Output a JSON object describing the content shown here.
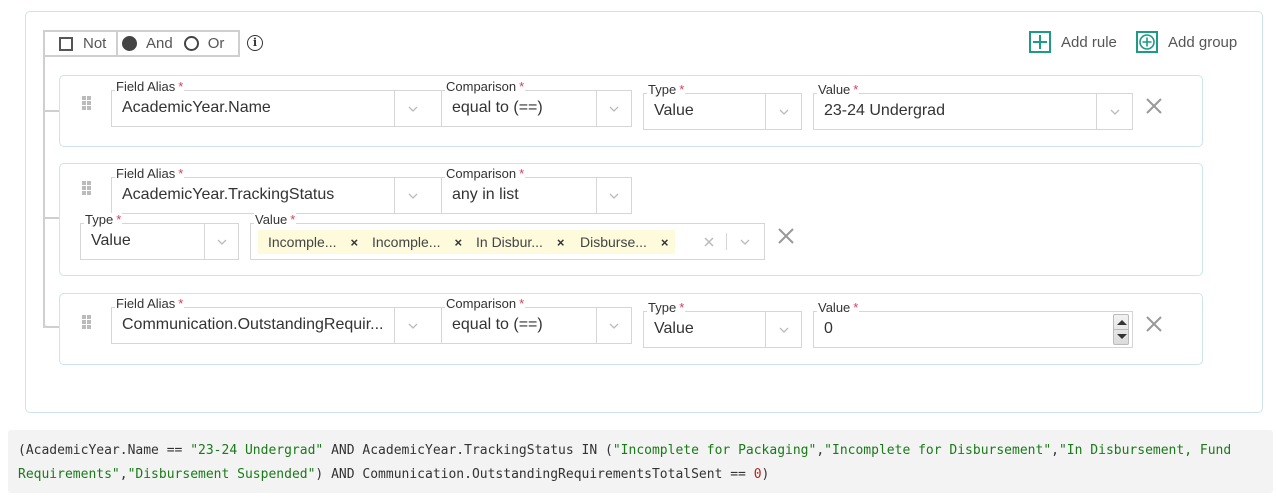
{
  "group": {
    "not_label": "Not",
    "and_label": "And",
    "or_label": "Or",
    "not_checked": false,
    "combinator": "And",
    "add_rule_label": "Add rule",
    "add_group_label": "Add group",
    "accent_color": "#1f9a85"
  },
  "rules": [
    {
      "field_alias_label": "Field Alias",
      "field_alias_value": "AcademicYear.Name",
      "comparison_label": "Comparison",
      "comparison_value": "equal to (==)",
      "type_label": "Type",
      "type_value": "Value",
      "value_label": "Value",
      "value_value": "23-24 Undergrad"
    },
    {
      "field_alias_label": "Field Alias",
      "field_alias_value": "AcademicYear.TrackingStatus",
      "comparison_label": "Comparison",
      "comparison_value": "any in list",
      "type_label": "Type",
      "type_value": "Value",
      "value_label": "Value",
      "value_tags": [
        "Incomple...",
        "Incomple...",
        "In Disbur...",
        "Disburse..."
      ],
      "tag_remove": "×"
    },
    {
      "field_alias_label": "Field Alias",
      "field_alias_value": "Communication.OutstandingRequir...",
      "comparison_label": "Comparison",
      "comparison_value": "equal to (==)",
      "type_label": "Type",
      "type_value": "Value",
      "value_label": "Value",
      "value_value": "0"
    }
  ],
  "required_marker": "*",
  "query": {
    "segments": [
      {
        "t": "plain",
        "v": "(AcademicYear.Name == "
      },
      {
        "t": "str",
        "v": "\"23-24 Undergrad\""
      },
      {
        "t": "plain",
        "v": " AND AcademicYear.TrackingStatus IN ("
      },
      {
        "t": "str",
        "v": "\"Incomplete for Packaging\""
      },
      {
        "t": "plain",
        "v": ","
      },
      {
        "t": "str",
        "v": "\"Incomplete for Disbursement\""
      },
      {
        "t": "plain",
        "v": ","
      },
      {
        "t": "str",
        "v": "\"In Disbursement, Fund Requirements\""
      },
      {
        "t": "plain",
        "v": ","
      },
      {
        "t": "str",
        "v": "\"Disbursement Suspended\""
      },
      {
        "t": "plain",
        "v": ") AND Communication.OutstandingRequirementsTotalSent == "
      },
      {
        "t": "num",
        "v": "0"
      },
      {
        "t": "plain",
        "v": ")"
      }
    ]
  }
}
